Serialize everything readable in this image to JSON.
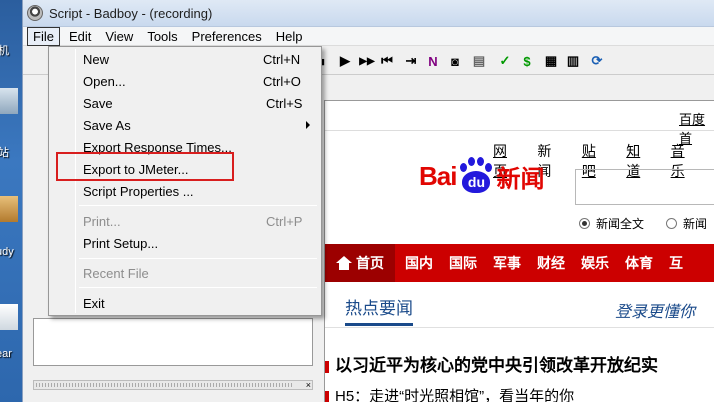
{
  "window": {
    "title": "Script - Badboy - (recording)"
  },
  "menubar": {
    "items": [
      "File",
      "Edit",
      "View",
      "Tools",
      "Preferences",
      "Help"
    ]
  },
  "desktop": {
    "labels": [
      "机",
      "站",
      "udy",
      "ear"
    ]
  },
  "file_menu": {
    "items": [
      {
        "label": "New",
        "shortcut": "Ctrl+N",
        "enabled": true
      },
      {
        "label": "Open...",
        "shortcut": "Ctrl+O",
        "enabled": true
      },
      {
        "label": "Save",
        "shortcut": "Ctrl+S",
        "enabled": true
      },
      {
        "label": "Save As",
        "shortcut": "",
        "enabled": true,
        "submenu": true
      },
      {
        "label": "Export Response Times...",
        "shortcut": "",
        "enabled": true
      },
      {
        "label": "Export to JMeter...",
        "shortcut": "",
        "enabled": true,
        "highlighted": true
      },
      {
        "label": "Script Properties ...",
        "shortcut": "",
        "enabled": true
      },
      {
        "label": "Print...",
        "shortcut": "Ctrl+P",
        "enabled": false
      },
      {
        "label": "Print Setup...",
        "shortcut": "",
        "enabled": true
      },
      {
        "label": "Recent File",
        "shortcut": "",
        "enabled": false
      },
      {
        "label": "Exit",
        "shortcut": "",
        "enabled": true
      }
    ]
  },
  "toolbar": {
    "buttons": [
      {
        "icon": "record-stop-icon",
        "glyph": "■"
      },
      {
        "icon": "play-icon",
        "glyph": "▶"
      },
      {
        "icon": "fast-forward-icon",
        "glyph": "▶▶"
      },
      {
        "icon": "skip-back-icon",
        "glyph": "⏮"
      },
      {
        "icon": "step-icon",
        "glyph": "⇥"
      },
      {
        "icon": "n-icon",
        "glyph": "N"
      },
      {
        "icon": "camera-icon",
        "glyph": "◙"
      },
      {
        "icon": "page-icon",
        "glyph": "▤"
      },
      {
        "icon": "check-icon",
        "glyph": "✓"
      },
      {
        "icon": "dollar-icon",
        "glyph": "$"
      },
      {
        "icon": "grid-icon",
        "glyph": "▦"
      },
      {
        "icon": "table-icon",
        "glyph": "▥"
      },
      {
        "icon": "refresh-icon",
        "glyph": "⟳"
      }
    ]
  },
  "browser": {
    "top_link": "百度首",
    "nav": [
      "网页",
      "新闻",
      "贴吧",
      "知道",
      "音乐"
    ],
    "logo": {
      "left": "Bai",
      "paw": "du",
      "right": "新闻"
    },
    "radios": [
      {
        "label": "新闻全文",
        "checked": true
      },
      {
        "label": "新闻",
        "checked": false
      }
    ],
    "categories": [
      "首页",
      "国内",
      "国际",
      "军事",
      "财经",
      "娱乐",
      "体育",
      "互"
    ],
    "hot_title": "热点要闻",
    "slogan": "登录更懂你",
    "headline": "以习近平为核心的党中央引领改革开放纪实",
    "subline": "H5：走进“时光照相馆”，看当年的你"
  },
  "colors": {
    "accent_red": "#cc0000",
    "highlight_border": "#d81e1e",
    "baidu_blue": "#2319dc"
  }
}
